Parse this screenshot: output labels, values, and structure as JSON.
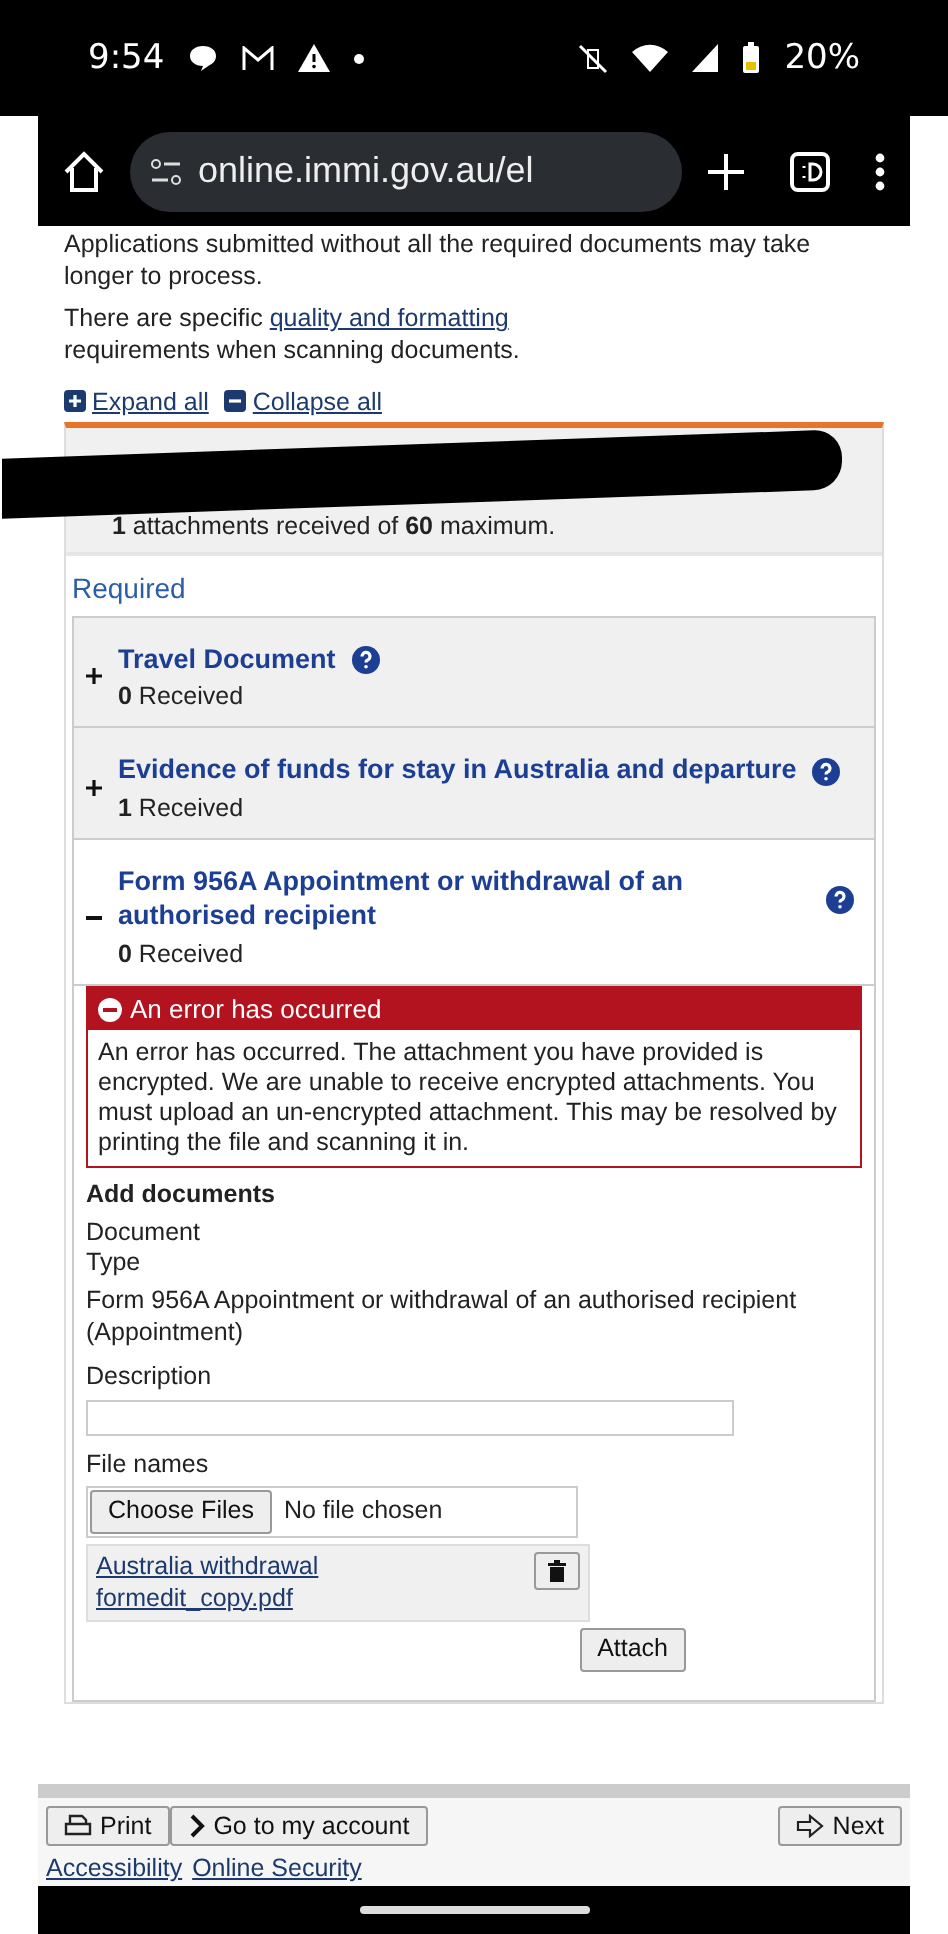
{
  "status_bar": {
    "time": "9:54",
    "battery": "20%"
  },
  "browser": {
    "url": "online.immi.gov.au/el"
  },
  "intro": {
    "text": "Applications submitted without all the required documents may take longer to process.",
    "note_before": "There are specific",
    "note_link": "quality and formatting",
    "note_after": "requirements when scanning documents."
  },
  "toggles": {
    "expand": "Expand all",
    "collapse": "Collapse all"
  },
  "summary": "**1** attachments received of **60** maximum.",
  "section_title": "Required",
  "documents": [
    {
      "title": "Travel Document",
      "received": "**0** Received",
      "expanded": false
    },
    {
      "title": "Evidence of funds for stay in Australia and departure",
      "received": "**1** Received",
      "expanded": false
    },
    {
      "title": "Form 956A Appointment or withdrawal of an authorised recipient",
      "received": "**0** Received",
      "expanded": true
    }
  ],
  "error": {
    "title": "An error has occurred",
    "message": "An error has occurred. The attachment you have provided is encrypted. We are unable to receive encrypted attachments. You must upload an un-encrypted attachment. This may be resolved by printing the file and scanning it in."
  },
  "add_documents": {
    "heading": "Add documents",
    "type_label": "Document Type",
    "type_value": "Form 956A Appointment or withdrawal of an authorised recipient (Appointment)",
    "description_label": "Description",
    "files_label": "File names",
    "choose_button": "Choose Files",
    "no_file": "No file chosen",
    "file": "Australia withdrawal formedit_copy.pdf",
    "attach_button": "Attach"
  },
  "footer": {
    "buttons": [
      {
        "kind": "print",
        "label": "Print"
      },
      {
        "kind": "account",
        "label": "Go to my account"
      },
      {
        "kind": "next",
        "label": "Next"
      }
    ],
    "links": [
      "Accessibility",
      "Online Security"
    ]
  }
}
